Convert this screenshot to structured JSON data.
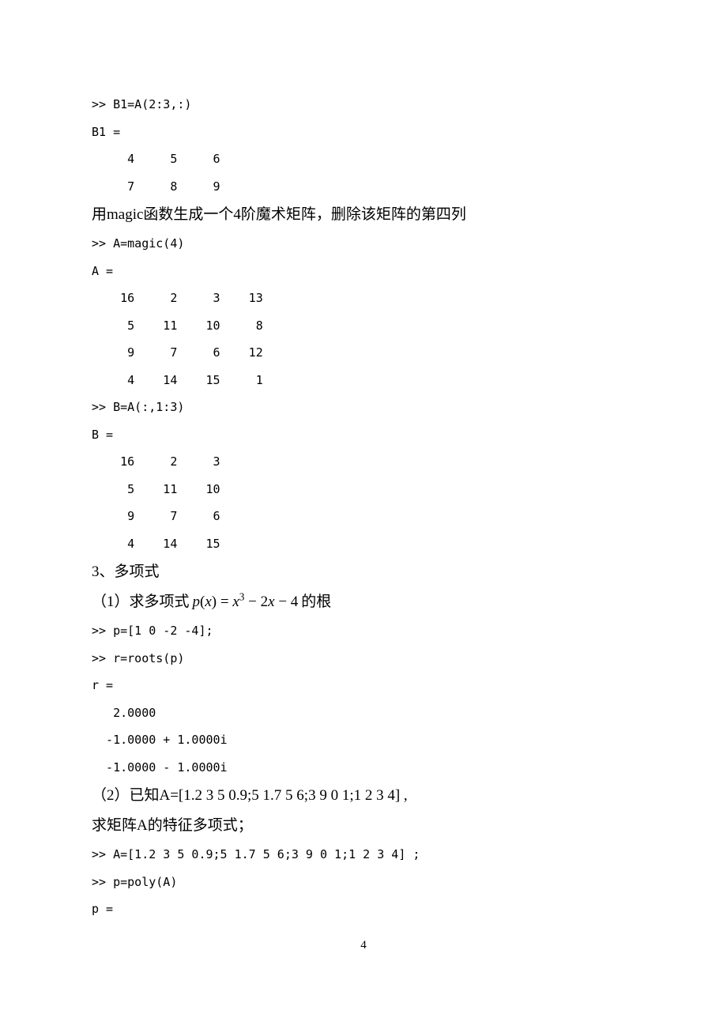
{
  "code1_l1": ">> B1=A(2:3,:)",
  "code1_l2": "B1 =",
  "code1_l3": "     4     5     6",
  "code1_l4": "     7     8     9",
  "text1": "用magic函数生成一个4阶魔术矩阵，删除该矩阵的第四列",
  "code2_l1": ">> A=magic(4)",
  "code2_l2": "A =",
  "code2_l3": "    16     2     3    13",
  "code2_l4": "     5    11    10     8",
  "code2_l5": "     9     7     6    12",
  "code2_l6": "     4    14    15     1",
  "code2_l7": ">> B=A(:,1:3)",
  "code2_l8": "B =",
  "code2_l9": "    16     2     3",
  "code2_l10": "     5    11    10",
  "code2_l11": "     9     7     6",
  "code2_l12": "     4    14    15",
  "text2": "3、多项式",
  "text3_pre": "（1）求多项式  ",
  "formula_p": "p",
  "formula_x": "x",
  "formula_eq": " = ",
  "formula_x3": "x",
  "formula_exp3": "3",
  "formula_m2": " − 2",
  "formula_x2": "x",
  "formula_m4": " − 4",
  "text3_post": "  的根",
  "code3_l1": ">> p=[1 0 -2 -4];",
  "code3_l2": ">> r=roots(p)",
  "code3_l3": "r =",
  "code3_l4": "   2.0000          ",
  "code3_l5": "  -1.0000 + 1.0000i",
  "code3_l6": "  -1.0000 - 1.0000i",
  "text4": "（2）已知A=[1.2 3 5 0.9;5 1.7 5 6;3 9 0 1;1 2 3 4] ,",
  "text5": "求矩阵A的特征多项式；",
  "code4_l1": ">> A=[1.2 3 5 0.9;5 1.7 5 6;3 9 0 1;1 2 3 4] ;",
  "code4_l2": ">> p=poly(A)",
  "code4_l3": "p =",
  "page_number": "4"
}
